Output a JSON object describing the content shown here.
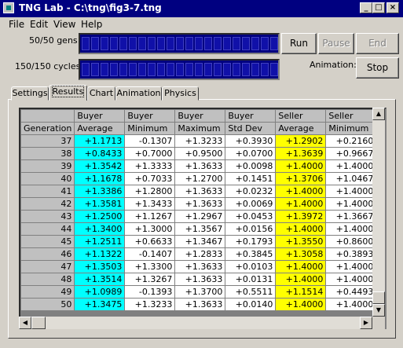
{
  "window": {
    "title": "TNG Lab - C:\\tng\\fig3-7.tng",
    "minimize": "_",
    "maximize": "□",
    "close": "×"
  },
  "menu": [
    "File",
    "Edit",
    "View",
    "Help"
  ],
  "gens_label": "50/50 gens",
  "cycles_label": "150/150 cycles",
  "gens_progress": 1.0,
  "cycles_progress": 1.0,
  "buttons": {
    "run": "Run",
    "pause": "Pause",
    "end": "End",
    "stop": "Stop"
  },
  "animation_label": "Animation:",
  "tabs": [
    "Settings",
    "Results",
    "Chart",
    "Animation",
    "Physics"
  ],
  "active_tab": "Results",
  "grid": {
    "header1": [
      "",
      "Buyer",
      "Buyer",
      "Buyer",
      "Buyer",
      "Seller",
      "Seller"
    ],
    "header2": [
      "Generation",
      "Average",
      "Minimum",
      "Maximum",
      "Std Dev",
      "Average",
      "Minimum"
    ],
    "rows": [
      [
        "37",
        "+1.1713",
        "-0.1307",
        "+1.3233",
        "+0.3930",
        "+1.2902",
        "+0.2160"
      ],
      [
        "38",
        "+0.8433",
        "+0.7000",
        "+0.9500",
        "+0.0700",
        "+1.3639",
        "+0.9667"
      ],
      [
        "39",
        "+1.3542",
        "+1.3333",
        "+1.3633",
        "+0.0098",
        "+1.4000",
        "+1.4000"
      ],
      [
        "40",
        "+1.1678",
        "+0.7033",
        "+1.2700",
        "+0.1451",
        "+1.3706",
        "+1.0467"
      ],
      [
        "41",
        "+1.3386",
        "+1.2800",
        "+1.3633",
        "+0.0232",
        "+1.4000",
        "+1.4000"
      ],
      [
        "42",
        "+1.3581",
        "+1.3433",
        "+1.3633",
        "+0.0069",
        "+1.4000",
        "+1.4000"
      ],
      [
        "43",
        "+1.2500",
        "+1.1267",
        "+1.2967",
        "+0.0453",
        "+1.3972",
        "+1.3667"
      ],
      [
        "44",
        "+1.3400",
        "+1.3000",
        "+1.3567",
        "+0.0156",
        "+1.4000",
        "+1.4000"
      ],
      [
        "45",
        "+1.2511",
        "+0.6633",
        "+1.3467",
        "+0.1793",
        "+1.3550",
        "+0.8600"
      ],
      [
        "46",
        "+1.1322",
        "-0.1407",
        "+1.2833",
        "+0.3845",
        "+1.3058",
        "+0.3893"
      ],
      [
        "47",
        "+1.3503",
        "+1.3300",
        "+1.3633",
        "+0.0103",
        "+1.4000",
        "+1.4000"
      ],
      [
        "48",
        "+1.3514",
        "+1.3267",
        "+1.3633",
        "+0.0131",
        "+1.4000",
        "+1.4000"
      ],
      [
        "49",
        "+1.0989",
        "-0.1393",
        "+1.3700",
        "+0.5511",
        "+1.1514",
        "+0.4493"
      ],
      [
        "50",
        "+1.3475",
        "+1.3233",
        "+1.3633",
        "+0.0140",
        "+1.4000",
        "+1.4000"
      ]
    ]
  },
  "colors": {
    "highlight_cyan": "#00ffff",
    "highlight_yellow": "#ffff00",
    "titlebar": "#000080"
  }
}
